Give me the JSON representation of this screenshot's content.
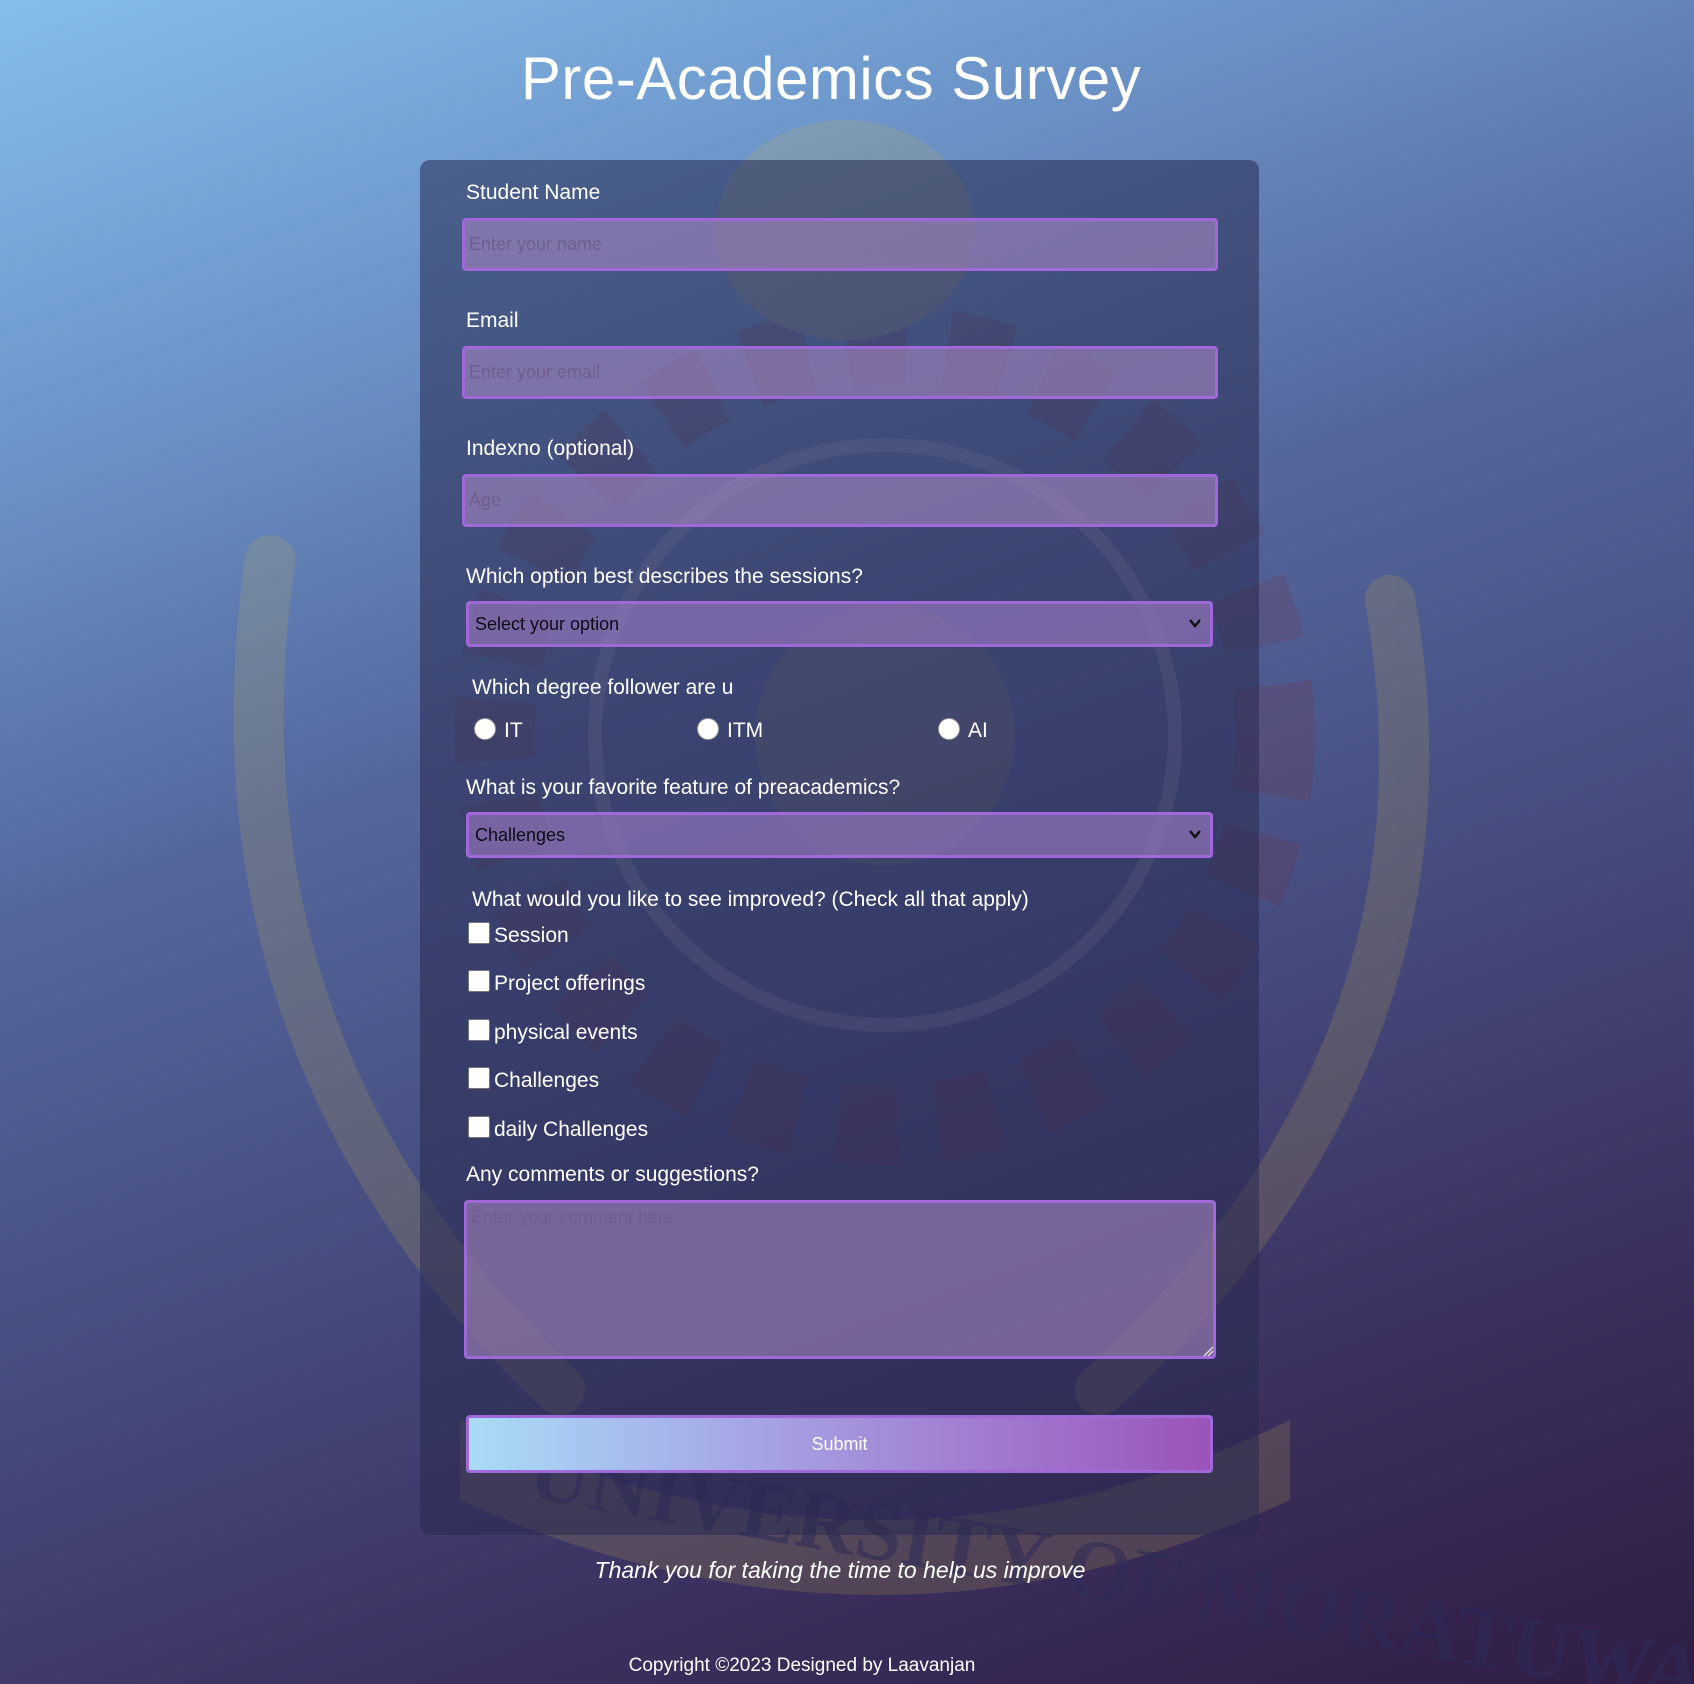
{
  "page": {
    "title": "Pre-Academics Survey"
  },
  "form": {
    "name": {
      "label": "Student Name",
      "placeholder": "Enter your name"
    },
    "email": {
      "label": "Email",
      "placeholder": "Enter your email"
    },
    "index": {
      "label": "Indexno (optional)",
      "placeholder": "Age"
    },
    "sessions": {
      "label": "Which option best describes the sessions?",
      "selected": "Select your option"
    },
    "degree": {
      "label": "Which degree follower are u",
      "options": [
        {
          "label": "IT",
          "checked": false
        },
        {
          "label": "ITM",
          "checked": false
        },
        {
          "label": "AI",
          "checked": false
        }
      ]
    },
    "favorite": {
      "label": "What is your favorite feature of preacademics?",
      "selected": "Challenges"
    },
    "improve": {
      "label": "What would you like to see improved? (Check all that apply)",
      "options": [
        {
          "label": "Session",
          "checked": false
        },
        {
          "label": "Project offerings",
          "checked": false
        },
        {
          "label": "physical events",
          "checked": false
        },
        {
          "label": "Challenges",
          "checked": false
        },
        {
          "label": "daily Challenges",
          "checked": false
        }
      ]
    },
    "comments": {
      "label": "Any comments or suggestions?",
      "placeholder": "Enter your comment here..."
    },
    "submit_label": "Submit"
  },
  "thanks_text": "Thank you for taking the time to help us improve",
  "footer_text": "Copyright ©2023 Designed by Laavanjan",
  "colors": {
    "accent_border": "#a068d8",
    "submit_gradient_start": "#a8dcf7",
    "submit_gradient_end": "#9b54bb"
  },
  "icons": {
    "select_arrow": "chevron-down-icon",
    "background": "university-emblem"
  }
}
